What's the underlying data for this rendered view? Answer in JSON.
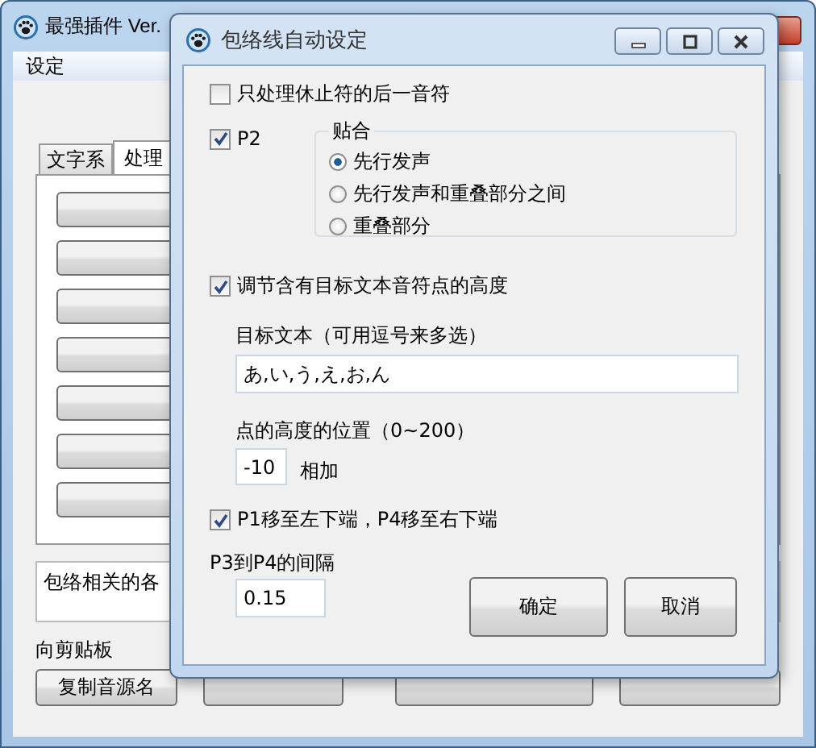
{
  "main_window": {
    "title": "最强插件 Ver.",
    "menu": [
      "设定"
    ],
    "tabs": [
      {
        "label": "文字系",
        "selected": false
      },
      {
        "label": "处理",
        "selected": true
      }
    ],
    "tab_buttons": [
      {
        "kind": "button"
      },
      {
        "kind": "button"
      },
      {
        "kind": "button"
      },
      {
        "kind": "button"
      },
      {
        "kind": "button"
      },
      {
        "kind": "button"
      },
      {
        "kind": "button"
      }
    ],
    "description": "包络相关的各",
    "clipboard_label": "向剪贴板",
    "clipboard_buttons": [
      {
        "kind": "button",
        "label": "复制音源名"
      },
      {
        "kind": "button"
      },
      {
        "kind": "button"
      },
      {
        "kind": "button"
      }
    ]
  },
  "dialog": {
    "title": "包络线自动设定",
    "rest_only": {
      "label": "只处理休止符的后一音符",
      "checked": false
    },
    "p2": {
      "label": "P2",
      "checked": true
    },
    "snap": {
      "title": "贴合",
      "options": [
        {
          "label": "先行发声",
          "selected": true
        },
        {
          "label": "先行发声和重叠部分之间",
          "selected": false
        },
        {
          "label": "重叠部分",
          "selected": false
        }
      ]
    },
    "adjust": {
      "label": "调节含有目标文本音符点的高度",
      "checked": true
    },
    "target_text": {
      "label": "目标文本（可用逗号来多选）",
      "value": "あ,い,う,え,お,ん"
    },
    "height": {
      "label": "点的高度的位置（0~200）",
      "value": "-10",
      "suffix": "相加"
    },
    "move": {
      "label": "P1移至左下端，P4移至右下端",
      "checked": true
    },
    "gap": {
      "label": "P3到P4的间隔",
      "value": "0.15"
    },
    "buttons": [
      "确定",
      "取消"
    ]
  }
}
